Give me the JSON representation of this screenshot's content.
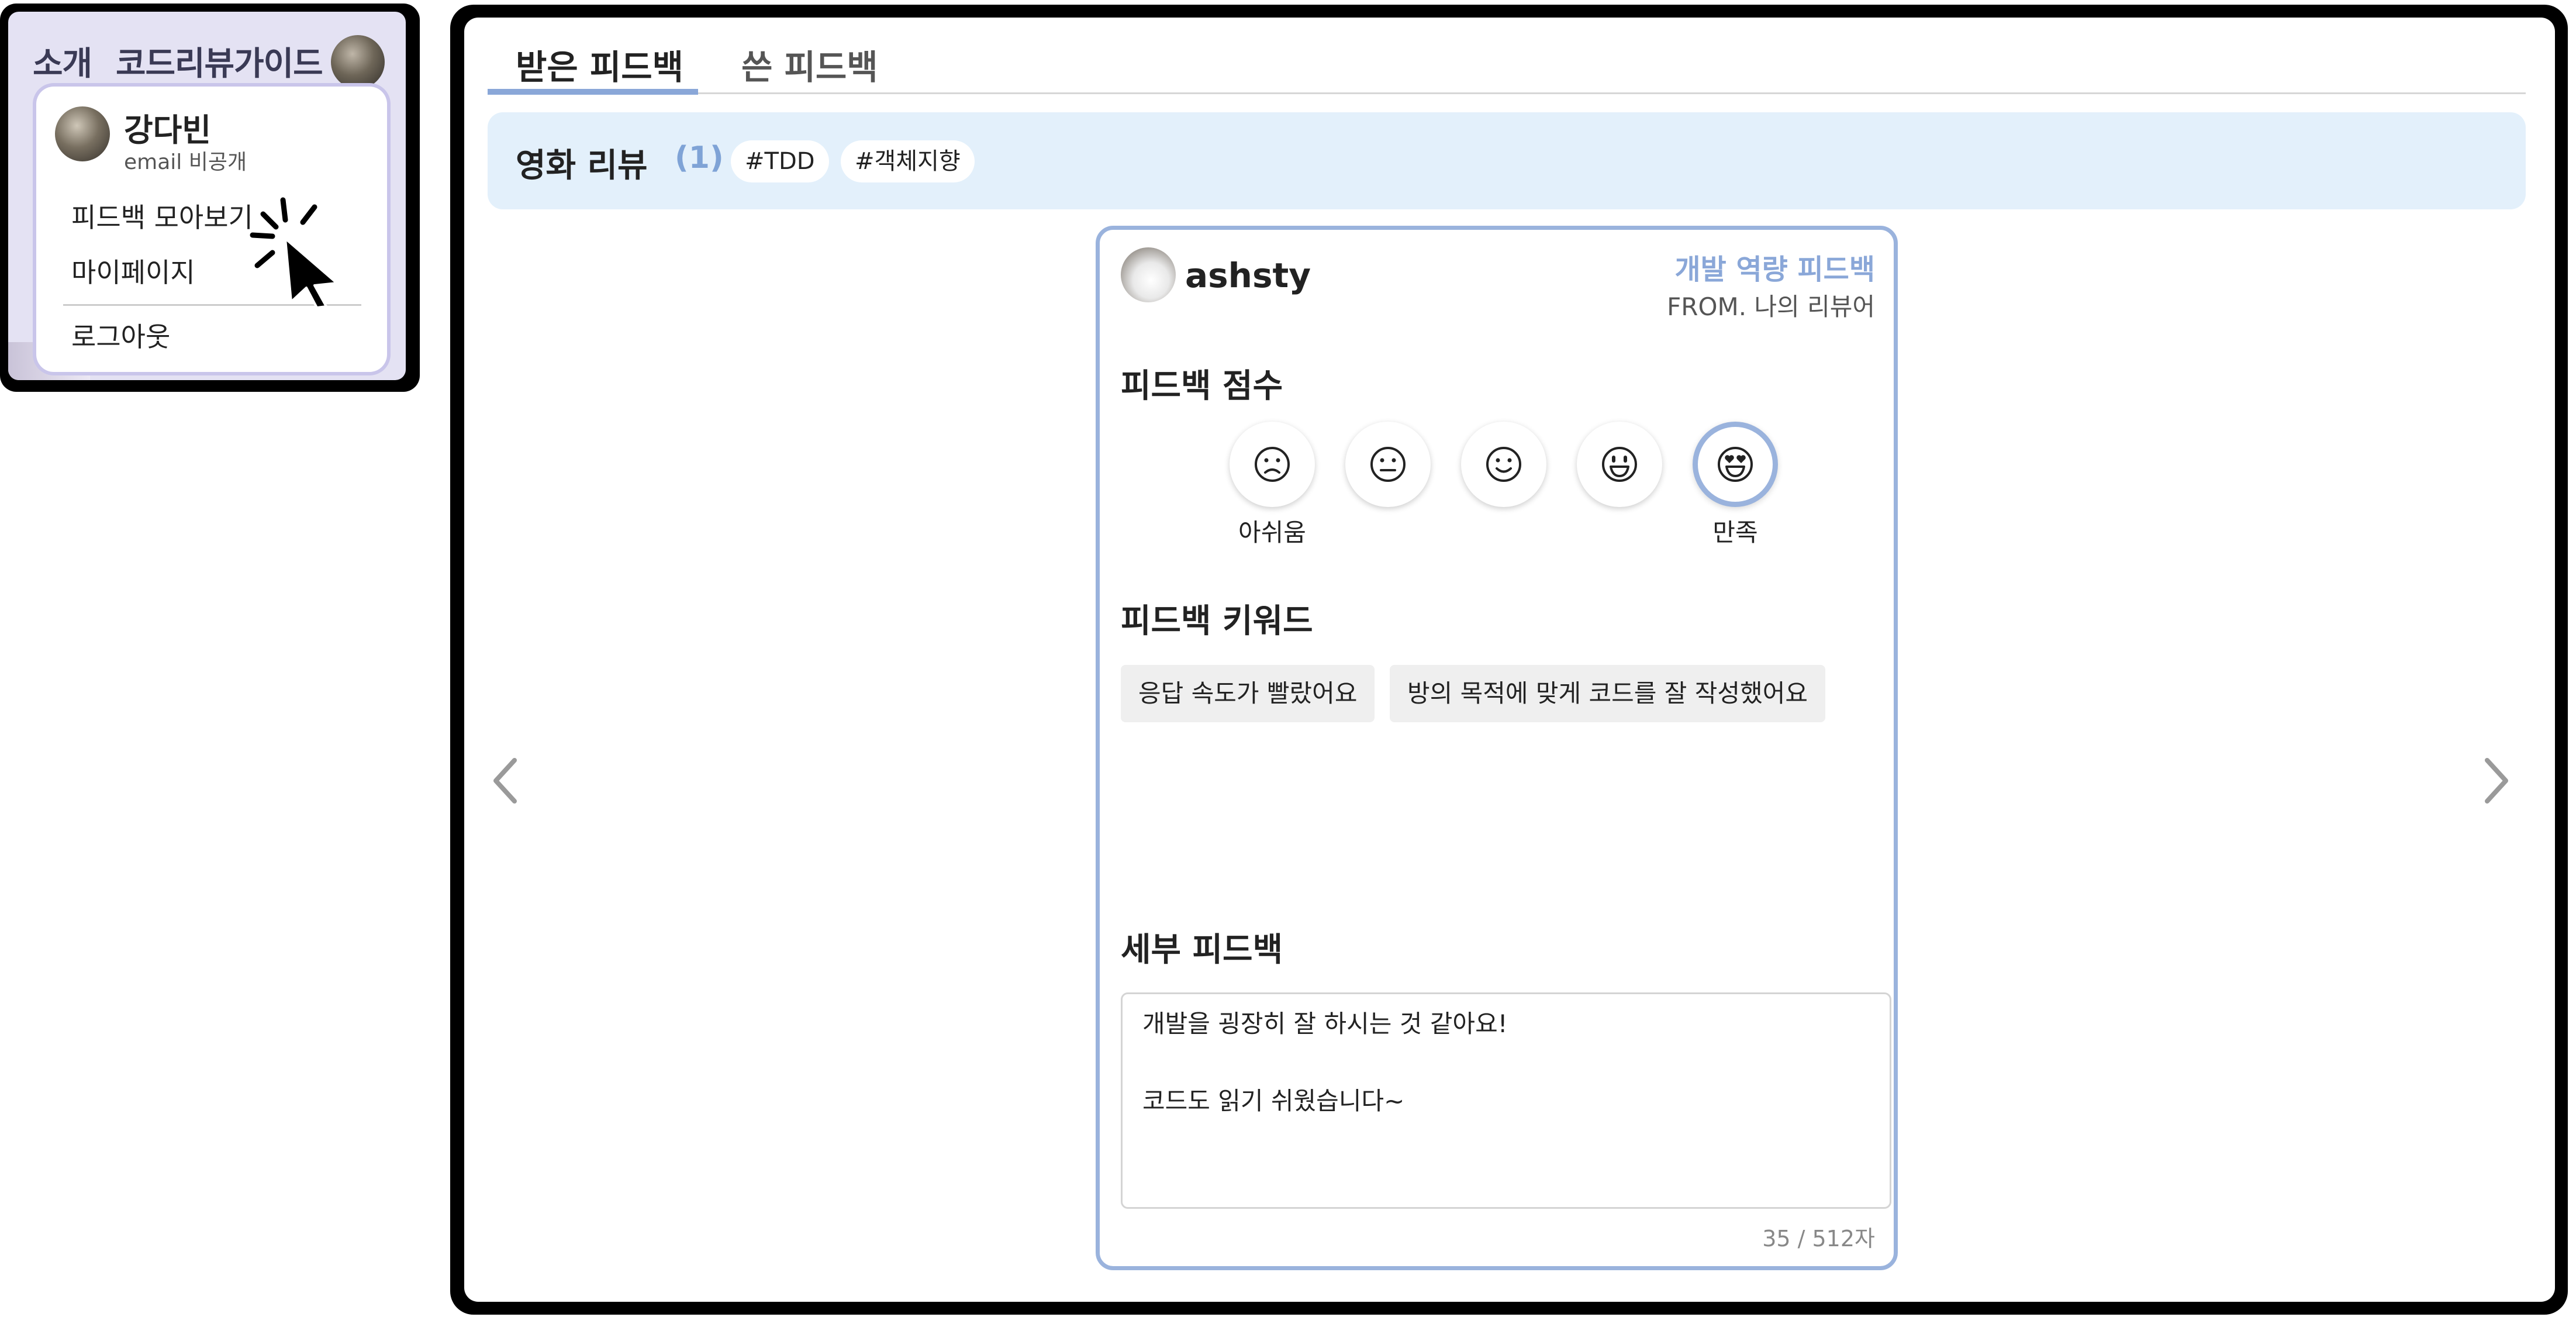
{
  "navbar": {
    "links": [
      "소개",
      "코드리뷰가이드"
    ]
  },
  "profile_menu": {
    "name": "강다빈",
    "email": "email 비공개",
    "items": [
      "피드백 모아보기",
      "마이페이지",
      "로그아웃"
    ]
  },
  "tabs": [
    {
      "label": "받은 피드백",
      "active": true
    },
    {
      "label": "쓴 피드백",
      "active": false
    }
  ],
  "room": {
    "title": "영화 리뷰",
    "count": "(1)",
    "tags": [
      "#TDD",
      "#객체지향"
    ]
  },
  "feedback": {
    "username": "ashsty",
    "type": "개발 역량 피드백",
    "from": "FROM. 나의 리뷰어",
    "score_title": "피드백 점수",
    "scores": [
      {
        "icon": "frown-face-icon",
        "label": "아쉬움",
        "selected": false
      },
      {
        "icon": "neutral-face-icon",
        "label": "",
        "selected": false
      },
      {
        "icon": "smile-face-icon",
        "label": "",
        "selected": false
      },
      {
        "icon": "grin-face-icon",
        "label": "",
        "selected": false
      },
      {
        "icon": "heart-eyes-face-icon",
        "label": "만족",
        "selected": true
      }
    ],
    "keyword_title": "피드백 키워드",
    "keywords": [
      "응답 속도가 빨랐어요",
      "방의 목적에 맞게 코드를 잘 작성했어요"
    ],
    "detail_title": "세부 피드백",
    "detail_lines": [
      "개발을 굉장히 잘 하시는 것 같아요!",
      "",
      "코드도 읽기 쉬웠습니다~"
    ],
    "char_count": "35 / 512자"
  },
  "colors": {
    "accent": "#8aa7d8",
    "card_border": "#9ab3dd",
    "banner_bg": "#e3f0fb",
    "popup_bg": "#e4e2f3"
  }
}
